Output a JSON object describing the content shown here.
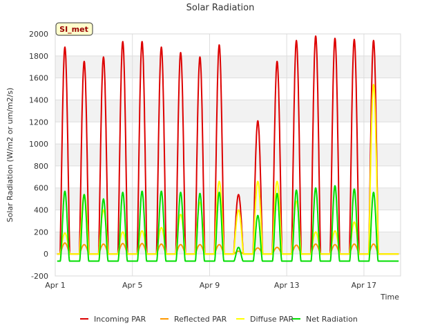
{
  "chart_data": {
    "type": "line",
    "title": "Solar Radiation",
    "xlabel": "Time",
    "ylabel": "Solar Radiation (W/m2 or um/m2/s)",
    "badge": "SI_met",
    "xlim": [
      0,
      17.9
    ],
    "ylim": [
      -200,
      2000
    ],
    "y_ticks": [
      -200,
      0,
      200,
      400,
      600,
      800,
      1000,
      1200,
      1400,
      1600,
      1800,
      2000
    ],
    "x_ticks": [
      {
        "x": 0,
        "label": "Apr 1"
      },
      {
        "x": 4,
        "label": "Apr 5"
      },
      {
        "x": 8,
        "label": "Apr 9"
      },
      {
        "x": 12,
        "label": "Apr 13"
      },
      {
        "x": 16,
        "label": "Apr 17"
      }
    ],
    "grid": true,
    "legend_position": "bottom",
    "x_units": "days from Apr 1",
    "series": [
      {
        "name": "Incoming PAR",
        "color": "#dd0000",
        "daily_peaks": [
          1880,
          1750,
          1790,
          1930,
          1930,
          1880,
          1830,
          1790,
          1900,
          540,
          1210,
          1750,
          1940,
          1980,
          1960,
          1950,
          1940
        ]
      },
      {
        "name": "Reflected PAR",
        "color": "#ff9900",
        "daily_peaks": [
          100,
          85,
          90,
          95,
          95,
          90,
          85,
          85,
          85,
          25,
          55,
          60,
          80,
          90,
          85,
          90,
          90
        ]
      },
      {
        "name": "Diffuse PAR",
        "color": "#ffff00",
        "daily_peaks": [
          190,
          540,
          400,
          200,
          210,
          240,
          360,
          470,
          660,
          400,
          660,
          660,
          480,
          200,
          210,
          290,
          1540
        ]
      },
      {
        "name": "Net Radiation",
        "color": "#00dd00",
        "daily_peaks": [
          570,
          540,
          500,
          560,
          570,
          570,
          560,
          550,
          560,
          60,
          350,
          550,
          580,
          600,
          620,
          590,
          560
        ],
        "night_value": -65
      }
    ]
  }
}
